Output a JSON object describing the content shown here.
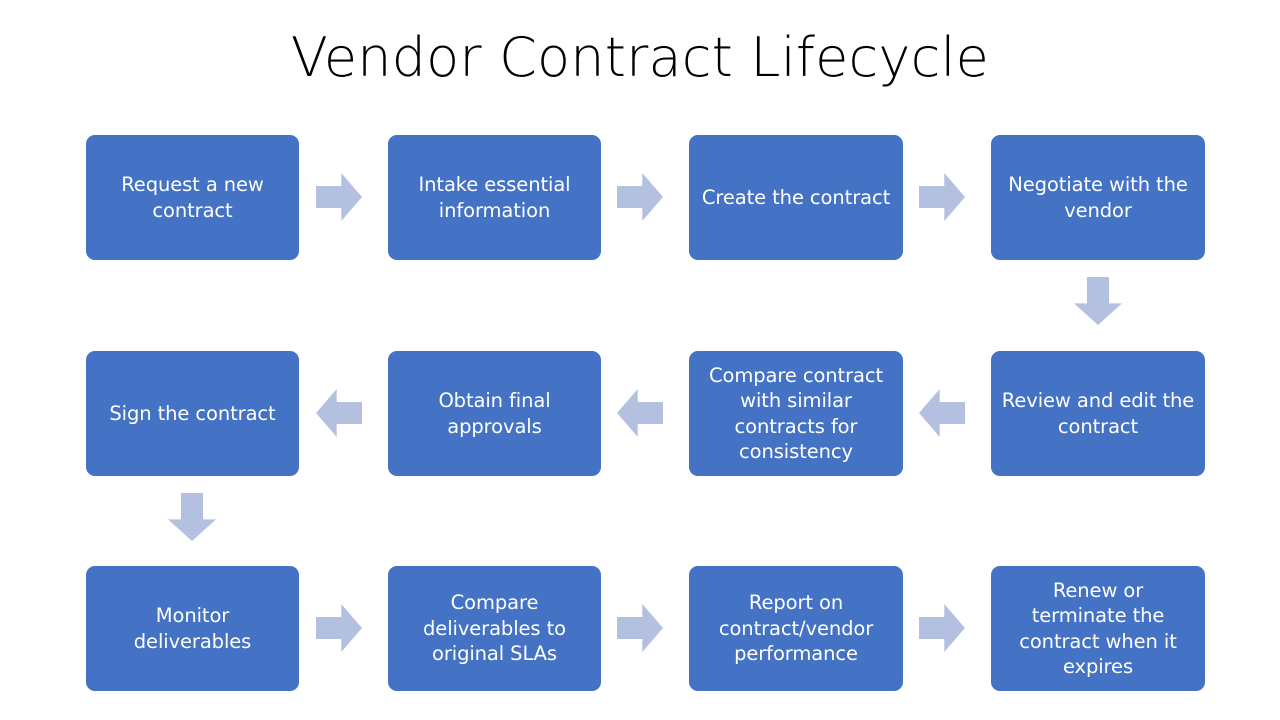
{
  "title": "Vendor Contract Lifecycle",
  "colors": {
    "node_fill": "#4472C4",
    "node_text": "#FFFFFF",
    "arrow_fill": "#B4C0E0",
    "background": "#FFFFFF",
    "title_text": "#000000"
  },
  "chart_data": {
    "type": "diagram",
    "diagram_kind": "process-flowchart",
    "title": "Vendor Contract Lifecycle",
    "flow_direction": "boustrophedon (row 1 left-to-right, row 2 right-to-left, row 3 left-to-right)",
    "node_count": 12,
    "nodes": [
      {
        "id": "n1",
        "row": 1,
        "col": 1,
        "label": "Request a new\ncontract"
      },
      {
        "id": "n2",
        "row": 1,
        "col": 2,
        "label": "Intake essential\ninformation"
      },
      {
        "id": "n3",
        "row": 1,
        "col": 3,
        "label": "Create the contract"
      },
      {
        "id": "n4",
        "row": 1,
        "col": 4,
        "label": "Negotiate with the\nvendor"
      },
      {
        "id": "n5",
        "row": 2,
        "col": 4,
        "label": "Review and edit the\ncontract"
      },
      {
        "id": "n6",
        "row": 2,
        "col": 3,
        "label": "Compare contract\nwith similar\ncontracts for\nconsistency"
      },
      {
        "id": "n7",
        "row": 2,
        "col": 2,
        "label": "Obtain final\napprovals"
      },
      {
        "id": "n8",
        "row": 2,
        "col": 1,
        "label": "Sign the contract"
      },
      {
        "id": "n9",
        "row": 3,
        "col": 1,
        "label": "Monitor\ndeliverables"
      },
      {
        "id": "n10",
        "row": 3,
        "col": 2,
        "label": "Compare\ndeliverables to\noriginal SLAs"
      },
      {
        "id": "n11",
        "row": 3,
        "col": 3,
        "label": "Report on\ncontract/vendor\nperformance"
      },
      {
        "id": "n12",
        "row": 3,
        "col": 4,
        "label": "Renew or\nterminate the\ncontract when it\nexpires"
      }
    ],
    "edges": [
      {
        "from": "n1",
        "to": "n2",
        "direction": "right"
      },
      {
        "from": "n2",
        "to": "n3",
        "direction": "right"
      },
      {
        "from": "n3",
        "to": "n4",
        "direction": "right"
      },
      {
        "from": "n4",
        "to": "n5",
        "direction": "down"
      },
      {
        "from": "n5",
        "to": "n6",
        "direction": "left"
      },
      {
        "from": "n6",
        "to": "n7",
        "direction": "left"
      },
      {
        "from": "n7",
        "to": "n8",
        "direction": "left"
      },
      {
        "from": "n8",
        "to": "n9",
        "direction": "down"
      },
      {
        "from": "n9",
        "to": "n10",
        "direction": "right"
      },
      {
        "from": "n10",
        "to": "n11",
        "direction": "right"
      },
      {
        "from": "n11",
        "to": "n12",
        "direction": "right"
      }
    ]
  }
}
